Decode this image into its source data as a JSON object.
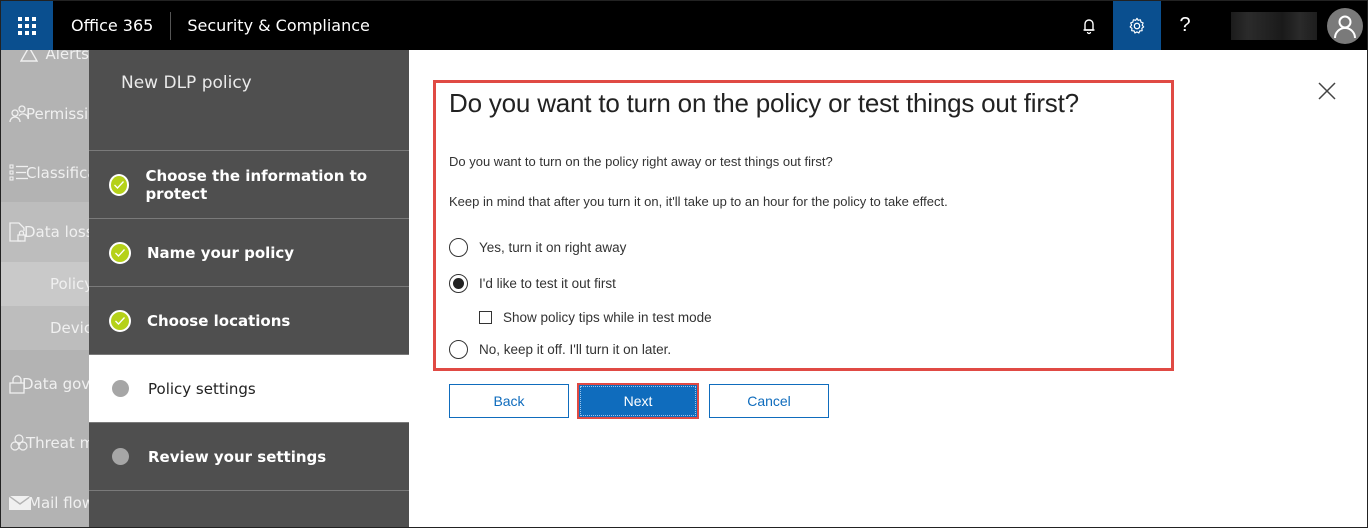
{
  "topbar": {
    "brand": "Office 365",
    "app_title": "Security & Compliance",
    "icons": [
      "waffle-icon",
      "bell-icon",
      "gear-icon",
      "help-icon",
      "avatar-icon"
    ],
    "help_glyph": "?",
    "colors": {
      "bar": "#000000",
      "active": "#0a4f8f"
    }
  },
  "leftnav": {
    "items": [
      {
        "label": "Alerts",
        "icon": "alert-icon"
      },
      {
        "label": "Permissions",
        "icon": "permissions-icon"
      },
      {
        "label": "Classifications",
        "icon": "classifications-icon"
      },
      {
        "label": "Data loss prevention",
        "icon": "data-loss-prevention-icon"
      },
      {
        "label": "Policy",
        "sub": true
      },
      {
        "label": "Device management",
        "sub": true
      },
      {
        "label": "Data governance",
        "icon": "lock-icon"
      },
      {
        "label": "Threat management",
        "icon": "biohazard-icon"
      },
      {
        "label": "Mail flow",
        "icon": "mail-icon"
      }
    ]
  },
  "wizard": {
    "title": "New DLP policy",
    "steps": [
      {
        "label": "Choose the information to protect",
        "status": "done"
      },
      {
        "label": "Name your policy",
        "status": "done"
      },
      {
        "label": "Choose locations",
        "status": "done"
      },
      {
        "label": "Policy settings",
        "status": "current"
      },
      {
        "label": "Review your settings",
        "status": "pending"
      }
    ],
    "colors": {
      "done": "#b5d119",
      "pending": "#a6a6a6",
      "panel": "#4f4f4f"
    }
  },
  "main": {
    "heading": "Do you want to turn on the policy or test things out first?",
    "description": "Do you want to turn on the policy right away or test things out first?",
    "note": "Keep in mind that after you turn it on, it'll take up to an hour for the policy to take effect.",
    "options": [
      {
        "label": "Yes, turn it on right away",
        "selected": false
      },
      {
        "label": "I'd like to test it out first",
        "selected": true
      },
      {
        "label": "No, keep it off. I'll turn it on later.",
        "selected": false
      }
    ],
    "test_tips_checkbox": {
      "label": "Show policy tips while in test mode",
      "checked": false
    },
    "buttons": {
      "back": "Back",
      "next": "Next",
      "cancel": "Cancel"
    },
    "colors": {
      "accent": "#0f6cbd",
      "highlight": "#e04a44"
    }
  }
}
